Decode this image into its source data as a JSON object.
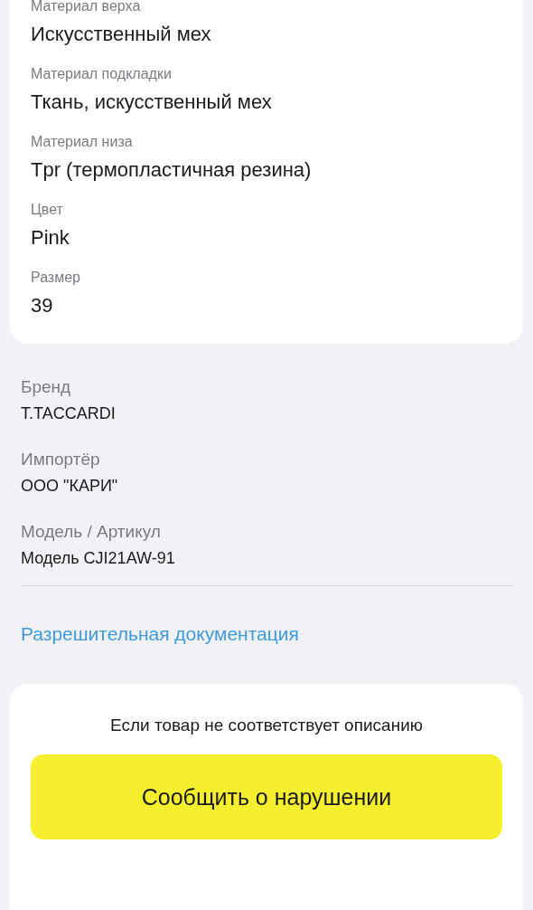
{
  "specs": [
    {
      "label": "Материал верха",
      "value": "Искусственный мех"
    },
    {
      "label": "Материал подкладки",
      "value": "Ткань, искусственный мех"
    },
    {
      "label": "Материал низа",
      "value": "Tpr (термопластичная резина)"
    },
    {
      "label": "Цвет",
      "value": "Pink"
    },
    {
      "label": "Размер",
      "value": "39"
    }
  ],
  "details": [
    {
      "label": "Бренд",
      "value": "T.TACCARDI"
    },
    {
      "label": "Импортёр",
      "value": "ООО \"КАРИ\""
    },
    {
      "label": "Модель / Артикул",
      "value": "Модель CJI21AW-91"
    }
  ],
  "docs_link": "Разрешительная документация",
  "report": {
    "note": "Если товар не соответствует описанию",
    "button": "Сообщить о нарушении"
  }
}
